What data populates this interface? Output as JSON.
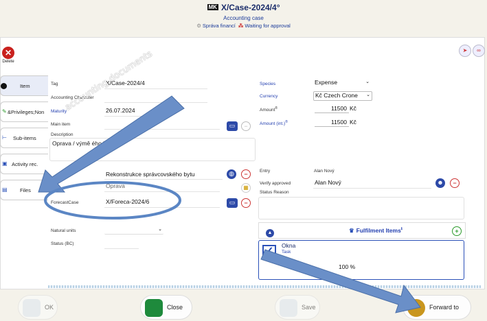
{
  "header": {
    "case_icon": "MK",
    "case_id": "X/Case-2024/4",
    "case_icon_suffix": "°",
    "case_type": "Accounting case",
    "status_left": "Správa financí",
    "status_right": "Waiting for approval"
  },
  "toolbar": {
    "delete_label": "Delete"
  },
  "sidebar": {
    "tabs": [
      {
        "label": "Item"
      },
      {
        "label": "&Privileges;Non"
      },
      {
        "label": "Sub-items"
      },
      {
        "label": "Activity rec."
      },
      {
        "label": "Files"
      }
    ]
  },
  "form": {
    "tag_label": "Tag",
    "tag_value": "X/Case-2024/4",
    "accounting_character_label": "Accounting Character",
    "accounting_character_value": "",
    "maturity_label": "Maturity",
    "maturity_value": "26.07.2024",
    "main_item_label": "Main item",
    "main_item_value": "",
    "description_label": "Description",
    "description_value": "Oprava / výmě                  ého kování",
    "project_value": "Rekonstrukce správcovského bytu",
    "area_label": "Area",
    "area_value": "Oprava",
    "forecast_case_label": "ForecastCase",
    "forecast_case_value": "X/Foreca-2024/6",
    "natural_units_label": "Natural units",
    "natural_units_value": "",
    "status_bc_label": "Status (BC)",
    "status_bc_value": "",
    "species_label": "Species",
    "species_value": "Expense",
    "currency_label": "Currency",
    "currency_value": "Kč Czech Crone",
    "amount_label": "Amount",
    "amount_sup": "®",
    "amount_value": "11500",
    "amount_unit": "Kč",
    "amount_int_label": "Amount (int.)",
    "amount_int_sup": "®",
    "amount_int_value": "11500",
    "amount_int_unit": "Kč",
    "entry_label": "Entry",
    "entry_value": "Alan Nový",
    "verify_label": "Verify approved",
    "verify_value": "Alan Nový",
    "status_reason_label": "Status Reason",
    "status_reason_value": ""
  },
  "fulfilment": {
    "count": "1",
    "title": "Fulfilment Items",
    "items": [
      {
        "title": "Okna",
        "type": "Task",
        "percent": "100",
        "unit": "%"
      }
    ]
  },
  "footer": {
    "ok_label": "OK",
    "close_label": "Close",
    "save_label": "Save",
    "forward_label": "Forward to"
  },
  "annotation": {
    "text": "accounting documents"
  },
  "colors": {
    "accent": "#2a50b8",
    "annotation_arrow": "#5b86c4",
    "delete_red": "#c9211e",
    "close_green": "#1e8a3c"
  }
}
